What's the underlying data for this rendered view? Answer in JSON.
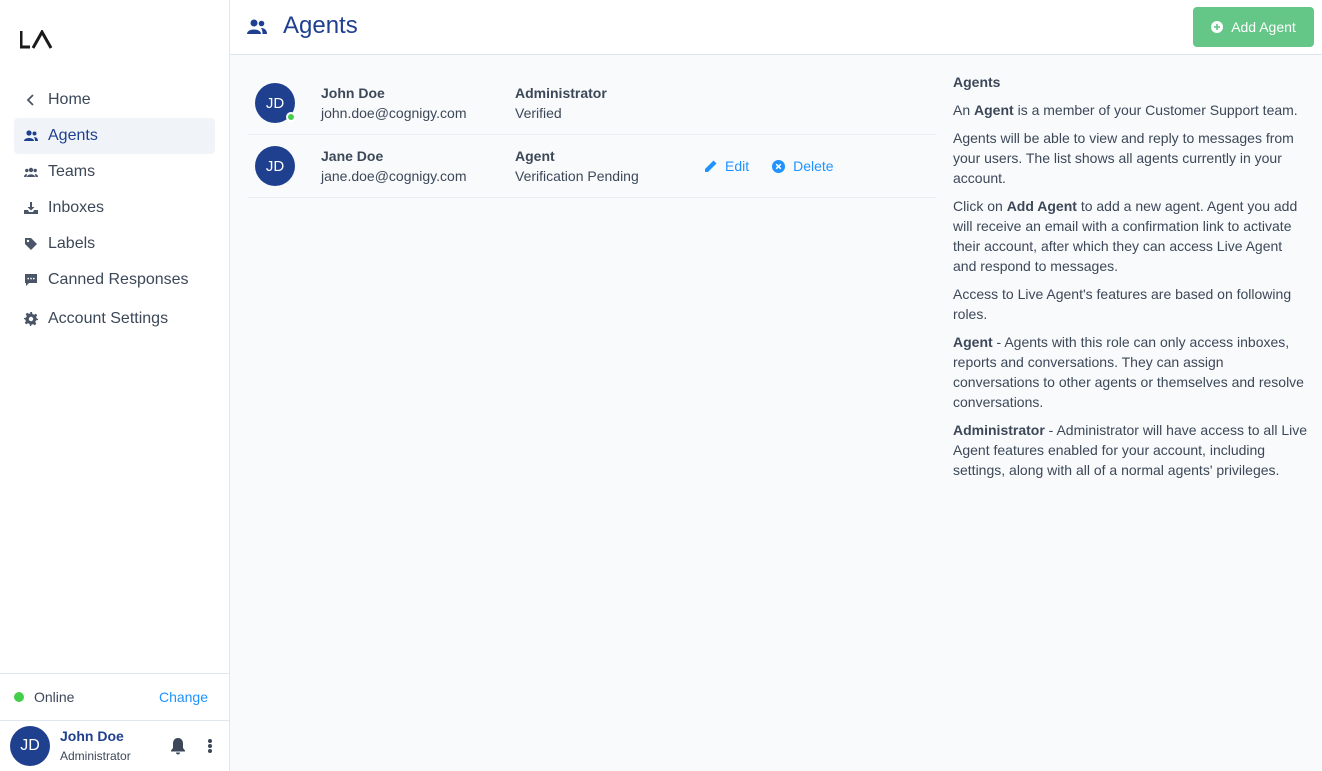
{
  "sidebar": {
    "logo": "LA",
    "items": [
      {
        "label": "Home",
        "icon": "chevron-left-icon"
      },
      {
        "label": "Agents",
        "icon": "agents-icon",
        "active": true
      },
      {
        "label": "Teams",
        "icon": "teams-icon"
      },
      {
        "label": "Inboxes",
        "icon": "inbox-icon"
      },
      {
        "label": "Labels",
        "icon": "tag-icon"
      },
      {
        "label": "Canned Responses",
        "icon": "chat-bubble-icon"
      },
      {
        "label": "Account Settings",
        "icon": "gear-icon"
      }
    ],
    "status": {
      "label": "Online",
      "action": "Change",
      "color": "#44ce4b"
    },
    "user": {
      "initials": "JD",
      "name": "John Doe",
      "role": "Administrator"
    }
  },
  "header": {
    "title": "Agents",
    "add_button": "Add Agent"
  },
  "agents": [
    {
      "initials": "JD",
      "name": "John Doe",
      "email": "john.doe@cognigy.com",
      "role": "Administrator",
      "status": "Verified",
      "online": true
    },
    {
      "initials": "JD",
      "name": "Jane Doe",
      "email": "jane.doe@cognigy.com",
      "role": "Agent",
      "status": "Verification Pending",
      "edit": "Edit",
      "delete": "Delete"
    }
  ],
  "help": {
    "title": "Agents",
    "p1_pre": "An ",
    "p1_bold": "Agent",
    "p1_post": " is a member of your Customer Support team.",
    "p2": "Agents will be able to view and reply to messages from your users. The list shows all agents currently in your account.",
    "p3_pre": "Click on ",
    "p3_bold": "Add Agent",
    "p3_post": " to add a new agent. Agent you add will receive an email with a confirmation link to activate their account, after which they can access Live Agent and respond to messages.",
    "p4": "Access to Live Agent's features are based on following roles.",
    "p5_bold": "Agent",
    "p5_post": " - Agents with this role can only access inboxes, reports and conversations. They can assign conversations to other agents or themselves and resolve conversations.",
    "p6_bold": "Administrator",
    "p6_post": " - Administrator will have access to all Live Agent features enabled for your account, including settings, along with all of a normal agents' privileges."
  },
  "colors": {
    "brand": "#1f3f8f",
    "accent": "#1f93ff",
    "success": "#64c787",
    "online": "#44ce4b"
  }
}
